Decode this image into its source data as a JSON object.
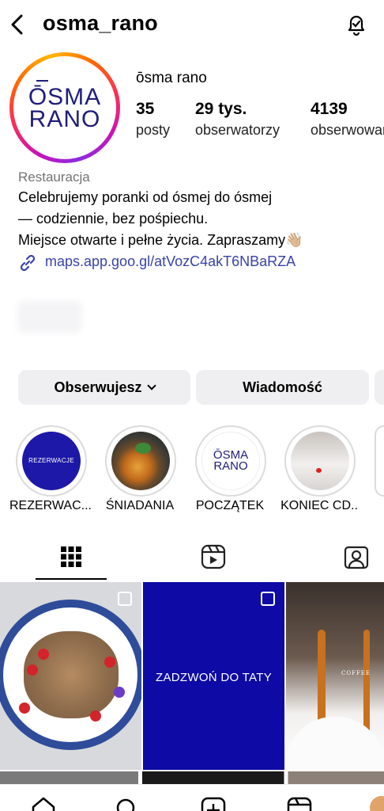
{
  "header": {
    "handle": "osma_rano"
  },
  "profile": {
    "avatar_logo_line1": "ŌSMA",
    "avatar_logo_line2": "RANO",
    "display_name": "ōsma rano",
    "stats": [
      {
        "value": "35",
        "label": "posty"
      },
      {
        "value": "29 tys.",
        "label": "obserwatorzy"
      },
      {
        "value": "4139",
        "label": "obserwowani"
      }
    ],
    "category": "Restauracja",
    "bio_lines": [
      "Celebrujemy poranki od ósmej do ósmej",
      "— codziennie, bez pośpiechu.",
      "Miejsce otwarte i pełne życia. Zapraszamy👋🏼"
    ],
    "link": "maps.app.goo.gl/atVozC4akT6NBaRZA"
  },
  "actions": {
    "follow": "Obserwujesz",
    "message": "Wiadomość"
  },
  "highlights": [
    {
      "label": "REZERWAC...",
      "cover_text": "REZERWACJE"
    },
    {
      "label": "ŚNIADANIA"
    },
    {
      "label": "POCZĄTEK",
      "cover_text_1": "ŌSMA",
      "cover_text_2": "RANO"
    },
    {
      "label": "KONIEC CD.."
    }
  ],
  "tabs": [
    {
      "icon": "grid-icon"
    },
    {
      "icon": "reels-icon"
    },
    {
      "icon": "tagged-icon"
    }
  ],
  "posts": [
    {
      "icon": "carousel-icon"
    },
    {
      "text": "ZADZWOŃ DO TATY",
      "icon": "carousel-icon"
    },
    {
      "text": "COFFEE"
    }
  ],
  "colors": {
    "link": "#3743a8",
    "brand_navy": "#1d18a8",
    "button_bg": "#efeff1"
  }
}
